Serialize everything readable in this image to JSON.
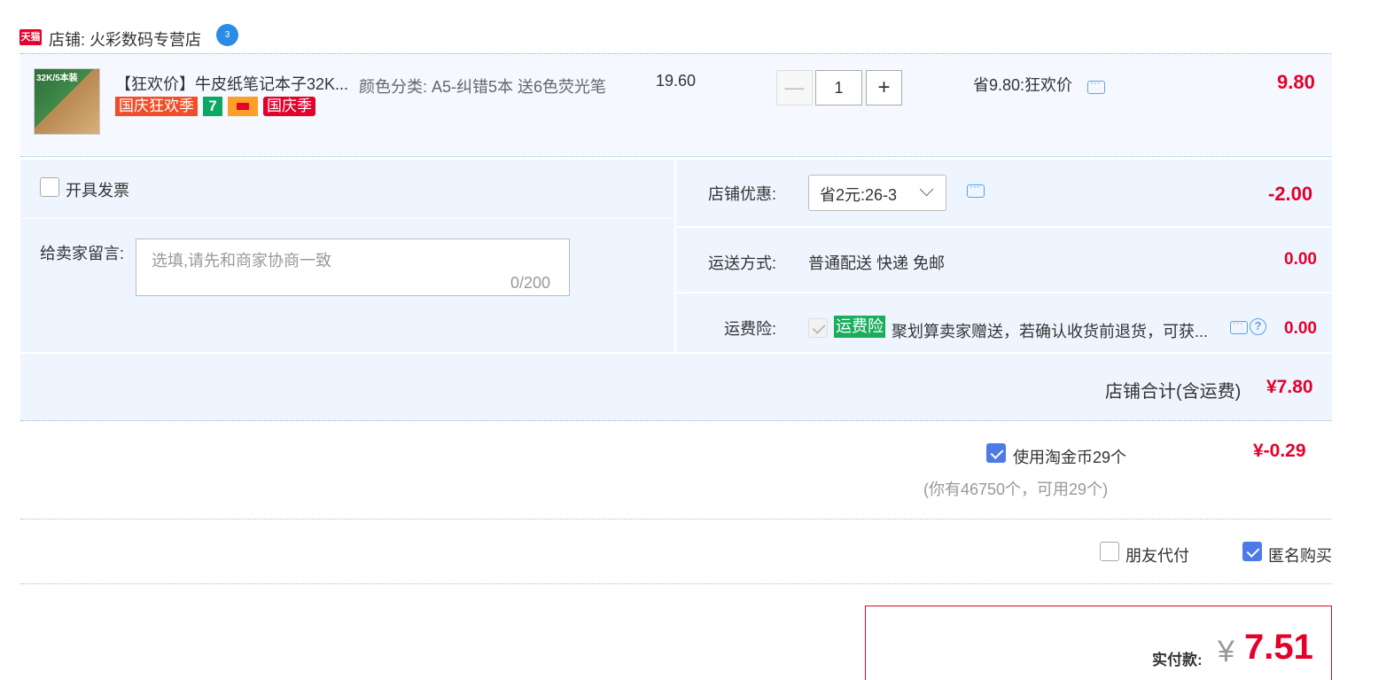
{
  "store": {
    "badge": "天猫",
    "label": "店铺: 火彩数码专营店",
    "wangwang": "3"
  },
  "item": {
    "thumb_text": "32K/5本装",
    "title": "【狂欢价】牛皮纸笔记本子32K...",
    "tags": [
      "国庆狂欢季",
      "7",
      "",
      "国庆季"
    ],
    "sku": "颜色分类: A5-纠错5本 送6色荧光笔",
    "unit_price": "19.60",
    "quantity": "1",
    "minus": "—",
    "plus": "+",
    "promo": "省9.80:狂欢价",
    "total": "9.80"
  },
  "options": {
    "invoice_label": "开具发票",
    "message_label": "给卖家留言:",
    "message_placeholder": "选填,请先和商家协商一致",
    "message_counter": "0/200",
    "shop_discount_label": "店铺优惠:",
    "shop_discount_value": "省2元:26-3",
    "shop_discount_amount": "-2.00",
    "shipping_label": "运送方式:",
    "shipping_value": "普通配送 快递 免邮",
    "shipping_fee": "0.00",
    "insurance_label": "运费险:",
    "insurance_badge": "运费险",
    "insurance_desc": "聚划算卖家赠送，若确认收货前退货，可获...",
    "insurance_help": "?",
    "insurance_fee": "0.00"
  },
  "subtotal": {
    "label": "店铺合计(含运费)",
    "value": "¥7.80"
  },
  "coins": {
    "label": "使用淘金币29个",
    "sub": "(你有46750个，可用29个)",
    "amount": "¥-0.29",
    "checked": true
  },
  "extras": {
    "friend_pay": "朋友代付",
    "anonymous": "匿名购买"
  },
  "payment": {
    "label": "实付款:",
    "currency": "¥",
    "value": "7.51"
  },
  "colors": {
    "accent_red": "#e4002b",
    "checkbox_blue": "#4e7ae5",
    "panel_bg": "#eff5ff",
    "insurance_green": "#1aad5c"
  }
}
